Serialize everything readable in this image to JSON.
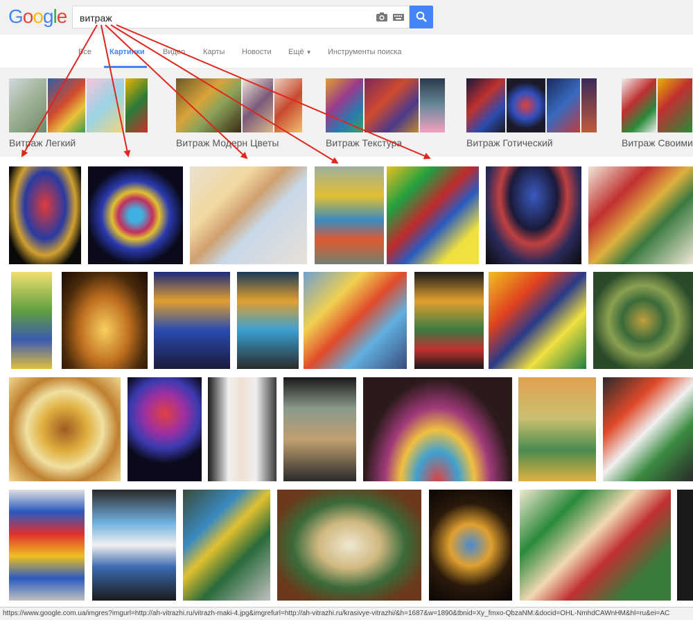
{
  "header": {
    "logo": [
      "G",
      "o",
      "o",
      "g",
      "l",
      "e"
    ],
    "logo_colors": [
      "#4285f4",
      "#ea4335",
      "#fbbc05",
      "#4285f4",
      "#34a853",
      "#ea4335"
    ],
    "search_value": "витраж",
    "camera_icon": "camera-icon",
    "keyboard_icon": "keyboard-icon",
    "search_icon": "search-icon"
  },
  "nav": {
    "tabs": [
      "Все",
      "Картинки",
      "Видео",
      "Карты",
      "Новости",
      "Ещё"
    ],
    "active_tab": "Картинки",
    "tools": "Инструменты поиска"
  },
  "chips": [
    {
      "label": "Витраж Легкий"
    },
    {
      "label": "Витраж Модерн Цветы"
    },
    {
      "label": "Витраж Текстура"
    },
    {
      "label": "Витраж Готический"
    },
    {
      "label": "Витраж Своими"
    }
  ],
  "status_url": "https://www.google.com.ua/imgres?imgurl=http://ah-vitrazhi.ru/vitrazh-maki-4.jpg&imgrefurl=http://ah-vitrazhi.ru/krasivye-vitrazhi/&h=1687&w=1890&tbnid=Xy_fmxo-QbzaNM:&docid=OHL-NmhdCAWnHM&hl=ru&ei=AC",
  "accent": "#4285f4",
  "arrow_color": "#e0261c"
}
